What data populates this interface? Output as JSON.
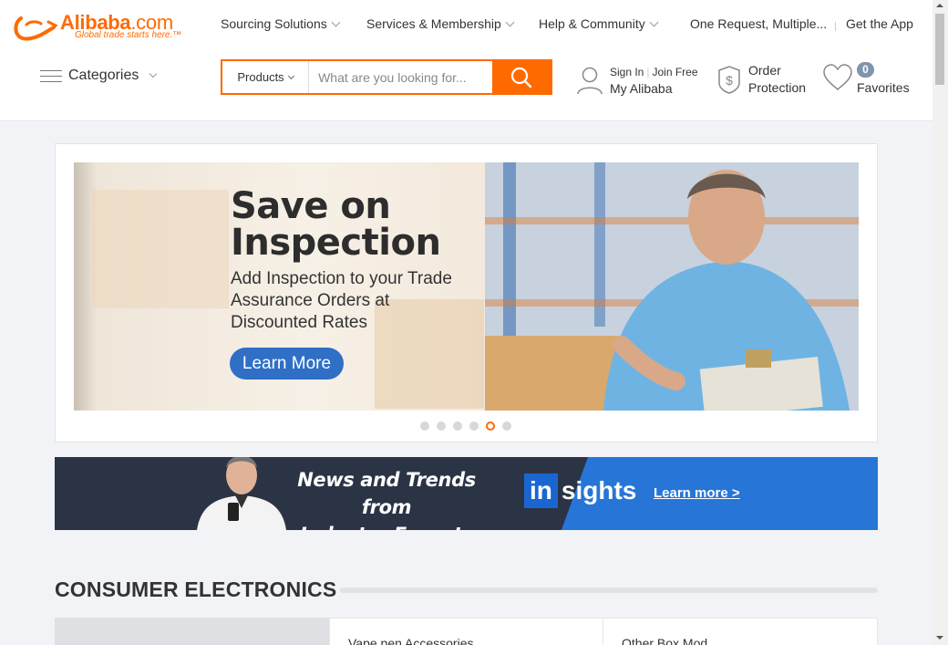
{
  "header": {
    "logo": {
      "brand": "Alibaba",
      "domain": ".com",
      "tagline": "Global trade starts here.™"
    },
    "topnav": [
      {
        "label": "Sourcing Solutions"
      },
      {
        "label": "Services & Membership"
      },
      {
        "label": "Help & Community"
      },
      {
        "label": "One Request, Multiple..."
      },
      {
        "label": "Get the App"
      }
    ],
    "categories_label": "Categories",
    "search": {
      "category": "Products",
      "placeholder": "What are you looking for...",
      "button_icon": "search-icon"
    },
    "account": {
      "sign_in": "Sign In",
      "join_free": "Join Free",
      "my_alibaba": "My Alibaba"
    },
    "order_protection": {
      "line1": "Order",
      "line2": "Protection"
    },
    "favorites": {
      "count": "0",
      "label": "Favorites"
    }
  },
  "banner": {
    "title_line1": "Save on",
    "title_line2": "Inspection",
    "subtitle": "Add Inspection to your Trade Assurance Orders at Discounted Rates",
    "button": "Learn More",
    "slides_total": 6,
    "active_slide": 5
  },
  "insights": {
    "headline_line1": "News and Trends from",
    "headline_line2": "Industry Experts",
    "brand_in": "in",
    "brand_rest": "sights",
    "link": "Learn more >"
  },
  "section": {
    "title": "CONSUMER ELECTRONICS",
    "cards": [
      "",
      "Vape pen Accessories",
      "Other Box Mod"
    ]
  },
  "colors": {
    "accent": "#ff6a00",
    "button_blue": "#2f6fc6",
    "insights_dark": "#2b3444",
    "insights_blue": "#2775d6"
  }
}
